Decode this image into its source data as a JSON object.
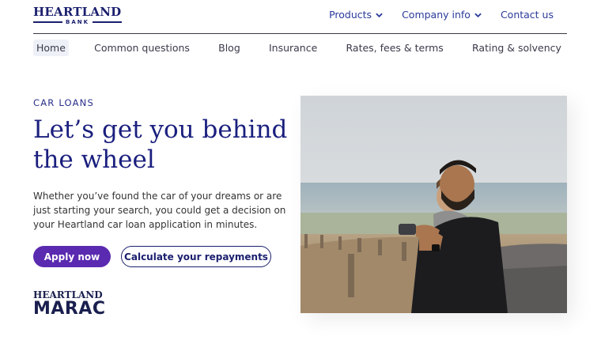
{
  "header": {
    "logo_top": "HEARTLAND",
    "logo_bottom": "BANK",
    "top_nav": [
      {
        "label": "Products",
        "has_dropdown": true
      },
      {
        "label": "Company info",
        "has_dropdown": true
      },
      {
        "label": "Contact us",
        "has_dropdown": false
      }
    ],
    "sub_nav": [
      {
        "label": "Home",
        "active": true
      },
      {
        "label": "Common questions"
      },
      {
        "label": "Blog"
      },
      {
        "label": "Insurance"
      },
      {
        "label": "Rates, fees & terms"
      },
      {
        "label": "Rating & solvency"
      }
    ]
  },
  "hero": {
    "eyebrow": "CAR LOANS",
    "headline": "Let’s get you behind the wheel",
    "body": "Whether you’ve found the car of your dreams or are just starting your search, you could get a decision on your Heartland car loan application in minutes.",
    "primary_button": "Apply now",
    "secondary_button": "Calculate your repayments"
  },
  "brand_logo": {
    "top": "HEARTLAND",
    "bottom": "MARAC"
  },
  "colors": {
    "navy": "#1a1f7e",
    "purple": "#5a2ab0",
    "link": "#2a3a9a"
  },
  "icons": [
    "chevron-down-icon"
  ]
}
